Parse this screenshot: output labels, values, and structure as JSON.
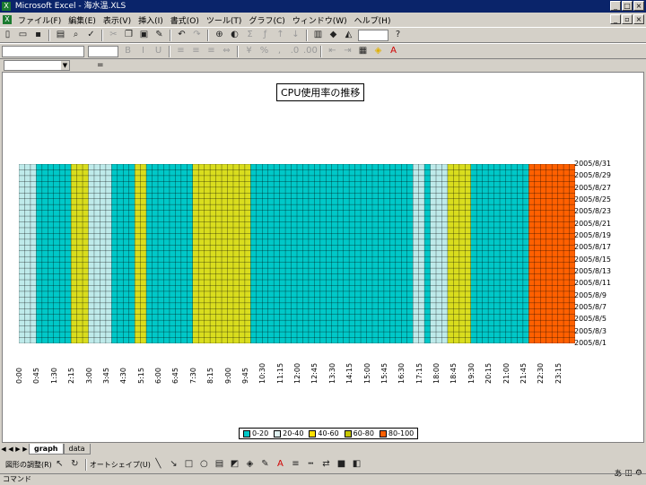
{
  "window": {
    "title": "Microsoft Excel - 海水温.XLS"
  },
  "menu": [
    "ファイル(F)",
    "編集(E)",
    "表示(V)",
    "挿入(I)",
    "書式(O)",
    "ツール(T)",
    "グラフ(C)",
    "ウィンドウ(W)",
    "ヘルプ(H)"
  ],
  "formula": {
    "fx": "="
  },
  "chart_data": {
    "type": "heatmap",
    "title": "CPU使用率の推移",
    "y_labels": [
      "2005/8/31",
      "2005/8/29",
      "2005/8/27",
      "2005/8/25",
      "2005/8/23",
      "2005/8/21",
      "2005/8/19",
      "2005/8/17",
      "2005/8/15",
      "2005/8/13",
      "2005/8/11",
      "2005/8/9",
      "2005/8/7",
      "2005/8/5",
      "2005/8/3",
      "2005/8/1"
    ],
    "x_labels": [
      "0:00",
      "0:45",
      "1:30",
      "2:15",
      "3:00",
      "3:45",
      "4:30",
      "5:15",
      "6:00",
      "6:45",
      "7:30",
      "8:15",
      "9:00",
      "9:45",
      "10:30",
      "11:15",
      "12:00",
      "12:45",
      "13:30",
      "14:15",
      "15:00",
      "15:45",
      "16:30",
      "17:15",
      "18:00",
      "18:45",
      "19:30",
      "20:15",
      "21:00",
      "21:45",
      "22:30",
      "23:15"
    ],
    "legend": [
      {
        "label": "0-20",
        "color": "#00c8c8"
      },
      {
        "label": "20-40",
        "color": "#dff0f0"
      },
      {
        "label": "40-60",
        "color": "#ffe000"
      },
      {
        "label": "60-80",
        "color": "#c8c800"
      },
      {
        "label": "80-100",
        "color": "#ff6000"
      }
    ],
    "bands": [
      {
        "from": "0:00",
        "to": "0:45",
        "level": "20-40"
      },
      {
        "from": "2:15",
        "to": "3:00",
        "level": "40-60"
      },
      {
        "from": "3:00",
        "to": "4:00",
        "level": "20-40"
      },
      {
        "from": "5:00",
        "to": "5:30",
        "level": "40-60"
      },
      {
        "from": "7:30",
        "to": "9:00",
        "level": "40-60"
      },
      {
        "from": "9:00",
        "to": "10:00",
        "level": "40-60"
      },
      {
        "from": "17:00",
        "to": "17:30",
        "level": "20-40"
      },
      {
        "from": "17:45",
        "to": "18:30",
        "level": "20-40"
      },
      {
        "from": "18:30",
        "to": "19:30",
        "level": "40-60"
      },
      {
        "from": "22:00",
        "to": "24:00",
        "level": "80-100"
      }
    ]
  },
  "sheet_tabs": [
    "graph",
    "data"
  ],
  "drawbar": {
    "adjust": "図形の調整(R)",
    "autoshape": "オートシェイプ(U)"
  },
  "status": "コマンド"
}
